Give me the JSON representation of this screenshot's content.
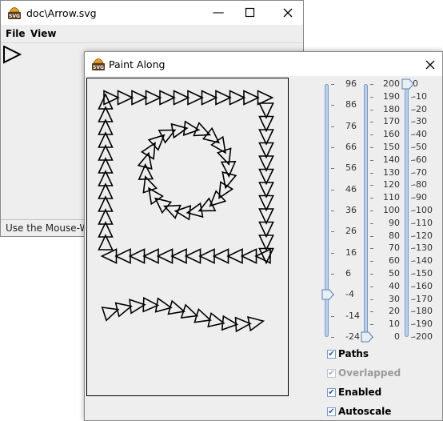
{
  "back_window": {
    "title": "doc\\Arrow.svg",
    "menus": [
      "File",
      "View"
    ],
    "status": "Use the Mouse-Wheel"
  },
  "front_window": {
    "title": "Paint Along"
  },
  "sliders": {
    "slider1": {
      "labels": [
        "96",
        "86",
        "76",
        "66",
        "56",
        "46",
        "36",
        "26",
        "16",
        "6",
        "-4",
        "-14",
        "-24"
      ],
      "value": -4
    },
    "slider2": {
      "labels": [
        "200",
        "190",
        "180",
        "170",
        "160",
        "150",
        "140",
        "130",
        "120",
        "110",
        "100",
        "90",
        "80",
        "70",
        "60",
        "50",
        "40",
        "30",
        "20",
        "10",
        "0"
      ],
      "value": 0
    },
    "slider3": {
      "labels": [
        "0",
        "-10",
        "-20",
        "-30",
        "-40",
        "-50",
        "-60",
        "-70",
        "-80",
        "-90",
        "-100",
        "-110",
        "-120",
        "-130",
        "-140",
        "-150",
        "-160",
        "-170",
        "-180",
        "-190",
        "-200"
      ],
      "value": 0
    }
  },
  "options": [
    {
      "label": "Paths",
      "checked": true,
      "enabled": true
    },
    {
      "label": "Overlapped",
      "checked": true,
      "enabled": false
    },
    {
      "label": "Enabled",
      "checked": true,
      "enabled": true
    },
    {
      "label": "Autoscale",
      "checked": true,
      "enabled": true
    }
  ],
  "colors": {
    "accent": "#7a9cc6",
    "track": "#b8d0ec",
    "canvas": "#eeeeee"
  },
  "icons": [
    "svg-app-icon",
    "minimize-icon",
    "maximize-icon",
    "close-icon",
    "arrow-cursor-icon",
    "checkbox-check-icon"
  ]
}
